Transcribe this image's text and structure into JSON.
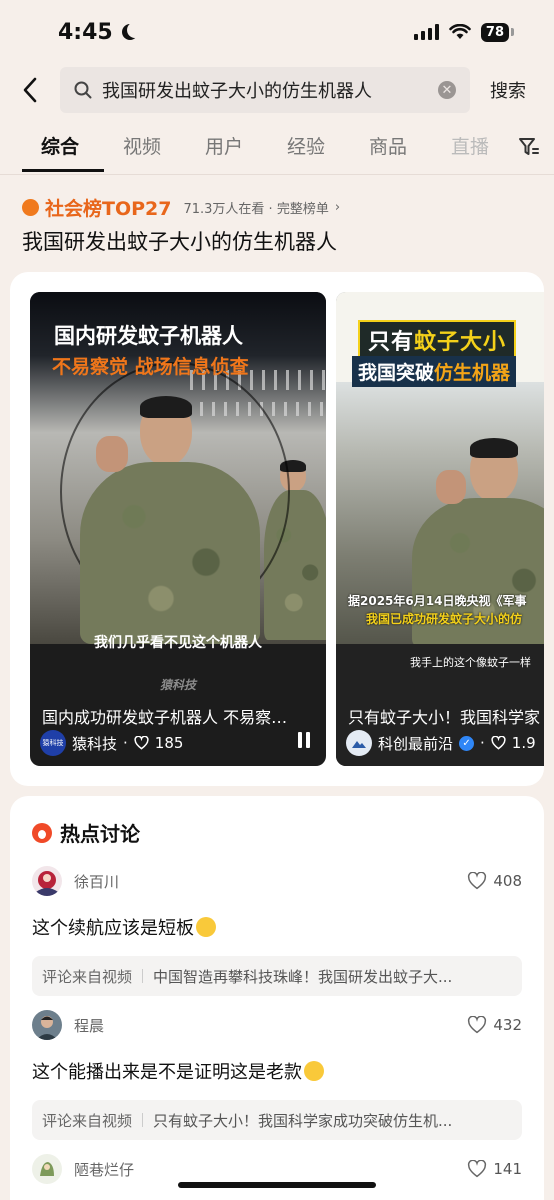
{
  "status_bar": {
    "time": "4:45",
    "battery": "78"
  },
  "search": {
    "query": "我国研发出蚊子大小的仿生机器人",
    "submit_label": "搜索"
  },
  "tabs": [
    "综合",
    "视频",
    "用户",
    "经验",
    "商品",
    "直播"
  ],
  "rank": {
    "title": "社会榜TOP27",
    "meta": "71.3万人在看 · 完整榜单",
    "chevron": "›",
    "topic": "我国研发出蚊子大小的仿生机器人"
  },
  "videos": [
    {
      "overlay_title": "国内研发蚊子机器人",
      "overlay_sub": "不易察觉 战场信息侦查",
      "caption": "我们几乎看不见这个机器人",
      "watermark": "猿科技",
      "title": "国内成功研发蚊子机器人 不易察…",
      "author": "猿科技",
      "avatar_text": "猿科技",
      "likes": "185"
    },
    {
      "overlay_line1_a": "只有",
      "overlay_line1_b": "蚊子大小",
      "overlay_line2_a": "我国突破",
      "overlay_line2_b": "仿生机器",
      "caption1": "据2025年6月14日晚央视《军事",
      "caption2": "我国已成功研发蚊子大小的仿",
      "caption3": "我手上的这个像蚊子一样",
      "title": "只有蚊子大小！我国科学家",
      "author": "科创最前沿",
      "likes": "1.9"
    }
  ],
  "hot_discussion": {
    "title": "热点讨论",
    "source_label": "评论来自视频",
    "comments": [
      {
        "name": "徐百川",
        "likes": "408",
        "text": "这个续航应该是短板",
        "source": "中国智造再攀科技珠峰！我国研发出蚊子大..."
      },
      {
        "name": "程晨",
        "likes": "432",
        "text": "这个能播出来是不是证明这是老款",
        "source": "只有蚊子大小！我国科学家成功突破仿生机..."
      },
      {
        "name": "陋巷烂仔",
        "likes": "141"
      }
    ]
  },
  "colors": {
    "accent": "#e8661b",
    "hot": "#f04a28",
    "background": "#f6efea"
  }
}
